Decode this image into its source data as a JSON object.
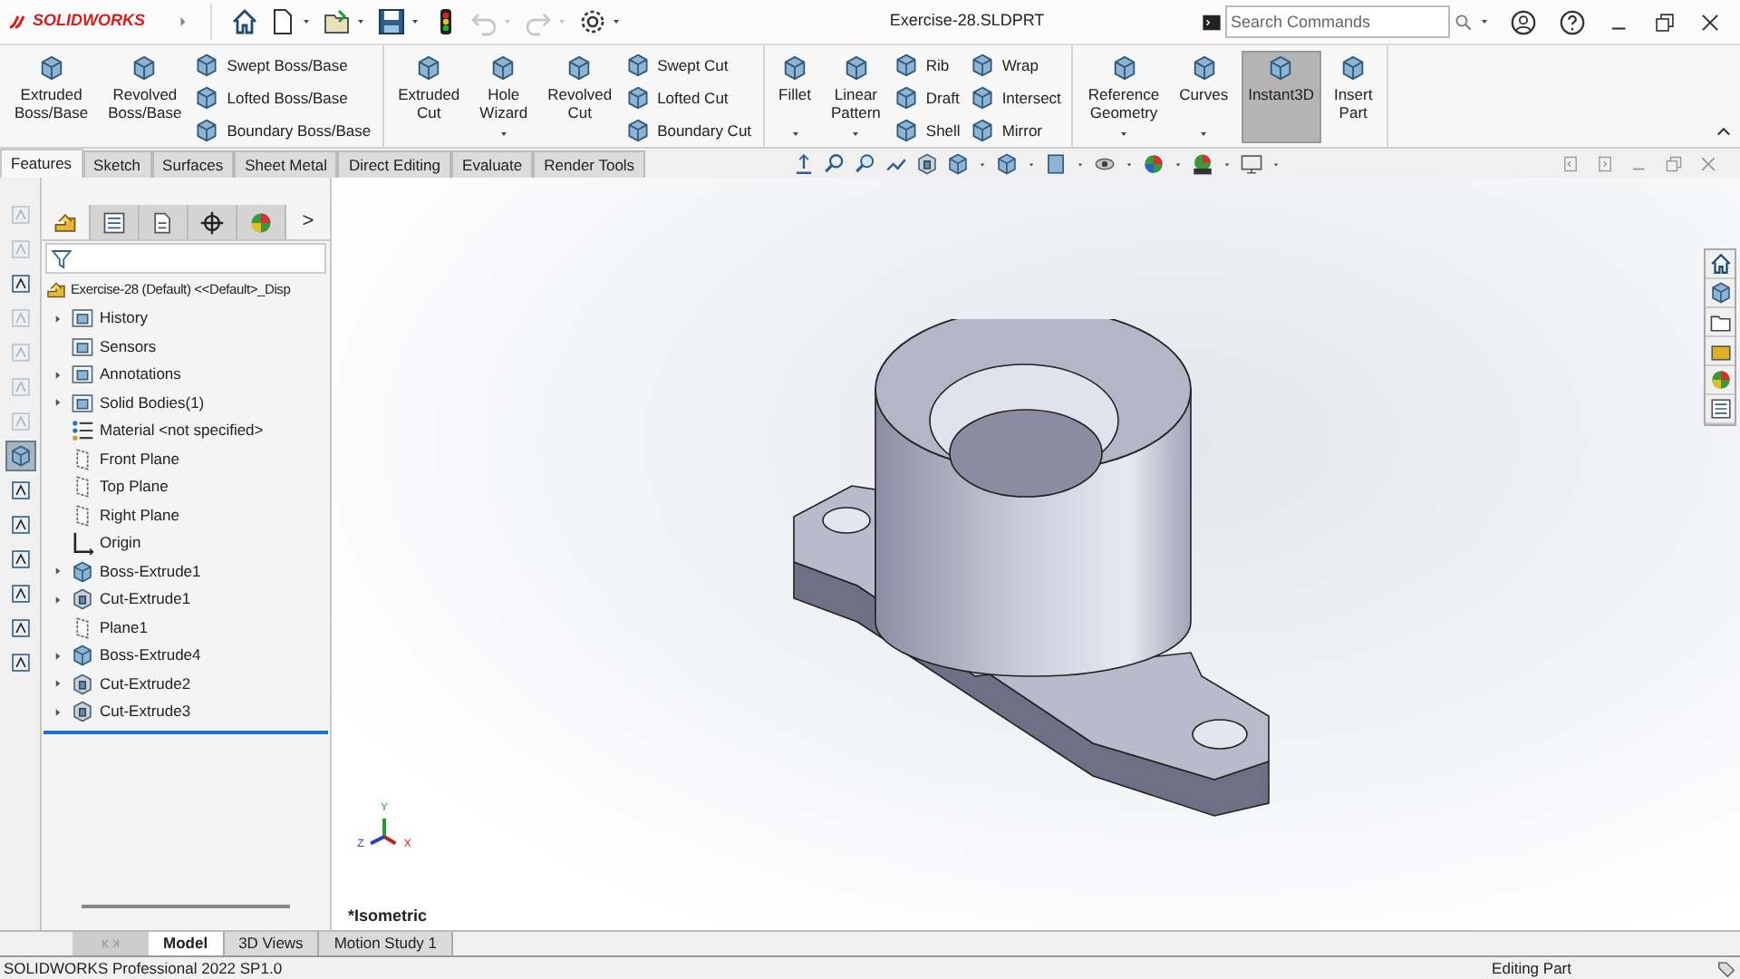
{
  "app": {
    "logo": "SOLIDWORKS",
    "title": "Exercise-28.SLDPRT"
  },
  "quick_access": [
    {
      "kind": "home",
      "dropdown": false,
      "disabled": false
    },
    {
      "kind": "new",
      "dropdown": true,
      "disabled": false
    },
    {
      "kind": "open",
      "dropdown": true,
      "disabled": false
    },
    {
      "kind": "save",
      "dropdown": true,
      "disabled": false
    },
    {
      "kind": "rebuild",
      "dropdown": false,
      "disabled": false
    },
    {
      "kind": "undo",
      "dropdown": true,
      "disabled": true
    },
    {
      "kind": "redo",
      "dropdown": true,
      "disabled": true
    },
    {
      "kind": "options",
      "dropdown": true,
      "disabled": false
    }
  ],
  "search": {
    "placeholder": "Search Commands"
  },
  "ribbon": [
    {
      "items": [
        {
          "kind": "large",
          "label": "Extruded Boss/Base",
          "dropdown": false,
          "selected": false
        },
        {
          "kind": "large",
          "label": "Revolved Boss/Base",
          "dropdown": false,
          "selected": false
        },
        {
          "kind": "stack",
          "buttons": [
            {
              "label": "Swept Boss/Base"
            },
            {
              "label": "Lofted Boss/Base"
            },
            {
              "label": "Boundary Boss/Base"
            }
          ]
        }
      ]
    },
    {
      "items": [
        {
          "kind": "large",
          "label": "Extruded Cut",
          "dropdown": false,
          "selected": false
        },
        {
          "kind": "large",
          "label": "Hole Wizard",
          "dropdown": true,
          "selected": false
        },
        {
          "kind": "large",
          "label": "Revolved Cut",
          "dropdown": false,
          "selected": false
        },
        {
          "kind": "stack",
          "buttons": [
            {
              "label": "Swept Cut"
            },
            {
              "label": "Lofted Cut"
            },
            {
              "label": "Boundary Cut"
            }
          ]
        }
      ]
    },
    {
      "items": [
        {
          "kind": "large",
          "label": "Fillet",
          "dropdown": true,
          "selected": false
        },
        {
          "kind": "large",
          "label": "Linear Pattern",
          "dropdown": true,
          "selected": false
        },
        {
          "kind": "stack",
          "buttons": [
            {
              "label": "Rib"
            },
            {
              "label": "Draft"
            },
            {
              "label": "Shell"
            }
          ]
        },
        {
          "kind": "stack",
          "buttons": [
            {
              "label": "Wrap"
            },
            {
              "label": "Intersect"
            },
            {
              "label": "Mirror"
            }
          ]
        }
      ]
    },
    {
      "items": [
        {
          "kind": "large",
          "label": "Reference Geometry",
          "dropdown": true,
          "selected": false
        },
        {
          "kind": "large",
          "label": "Curves",
          "dropdown": true,
          "selected": false
        },
        {
          "kind": "large",
          "label": "Instant3D",
          "dropdown": false,
          "selected": true
        },
        {
          "kind": "large",
          "label": "Insert Part",
          "dropdown": false,
          "selected": false
        }
      ]
    }
  ],
  "ribbon_tabs": [
    {
      "label": "Features",
      "selected": true
    },
    {
      "label": "Sketch",
      "selected": false
    },
    {
      "label": "Surfaces",
      "selected": false
    },
    {
      "label": "Sheet Metal",
      "selected": false
    },
    {
      "label": "Direct Editing",
      "selected": false
    },
    {
      "label": "Evaluate",
      "selected": false
    },
    {
      "label": "Render Tools",
      "selected": false
    }
  ],
  "left_toolbar": [
    {
      "disabled": true,
      "selected": false
    },
    {
      "disabled": true,
      "selected": false
    },
    {
      "disabled": false,
      "selected": false
    },
    {
      "disabled": true,
      "selected": false
    },
    {
      "disabled": true,
      "selected": false
    },
    {
      "disabled": true,
      "selected": false
    },
    {
      "disabled": true,
      "selected": false
    },
    {
      "disabled": false,
      "selected": true
    },
    {
      "disabled": false,
      "selected": false
    },
    {
      "disabled": false,
      "selected": false
    },
    {
      "disabled": false,
      "selected": false
    },
    {
      "disabled": false,
      "selected": false
    },
    {
      "disabled": false,
      "selected": false
    },
    {
      "disabled": false,
      "selected": false
    }
  ],
  "panel_tabs": [
    {
      "selected": true
    },
    {
      "selected": false
    },
    {
      "selected": false
    },
    {
      "selected": false
    },
    {
      "selected": false
    }
  ],
  "panel_more": ">",
  "tree": {
    "root": "Exercise-28 (Default) <<Default>_Disp",
    "items": [
      {
        "label": "History",
        "kind": "folder",
        "collapsed": true
      },
      {
        "label": "Sensors",
        "kind": "folder",
        "collapsed": false
      },
      {
        "label": "Annotations",
        "kind": "folder",
        "collapsed": true
      },
      {
        "label": "Solid Bodies(1)",
        "kind": "folder",
        "collapsed": true
      },
      {
        "label": "Material <not specified>",
        "kind": "material",
        "collapsed": false
      },
      {
        "label": "Front Plane",
        "kind": "plane",
        "collapsed": false
      },
      {
        "label": "Top Plane",
        "kind": "plane",
        "collapsed": false
      },
      {
        "label": "Right Plane",
        "kind": "plane",
        "collapsed": false
      },
      {
        "label": "Origin",
        "kind": "origin",
        "collapsed": false
      },
      {
        "label": "Boss-Extrude1",
        "kind": "boss",
        "collapsed": true
      },
      {
        "label": "Cut-Extrude1",
        "kind": "cut",
        "collapsed": true
      },
      {
        "label": "Plane1",
        "kind": "plane",
        "collapsed": false
      },
      {
        "label": "Boss-Extrude4",
        "kind": "boss",
        "collapsed": true
      },
      {
        "label": "Cut-Extrude2",
        "kind": "cut",
        "collapsed": true
      },
      {
        "label": "Cut-Extrude3",
        "kind": "cut",
        "collapsed": true
      }
    ]
  },
  "viewport": {
    "view_name": "*Isometric",
    "triad": {
      "y": "Y",
      "x": "X",
      "z": "Z"
    }
  },
  "bottom_tabs": [
    {
      "label": "Model",
      "selected": true
    },
    {
      "label": "3D Views",
      "selected": false
    },
    {
      "label": "Motion Study 1",
      "selected": false
    }
  ],
  "status_bar": {
    "left": "SOLIDWORKS Professional 2022 SP1.0",
    "right": "Editing Part"
  }
}
